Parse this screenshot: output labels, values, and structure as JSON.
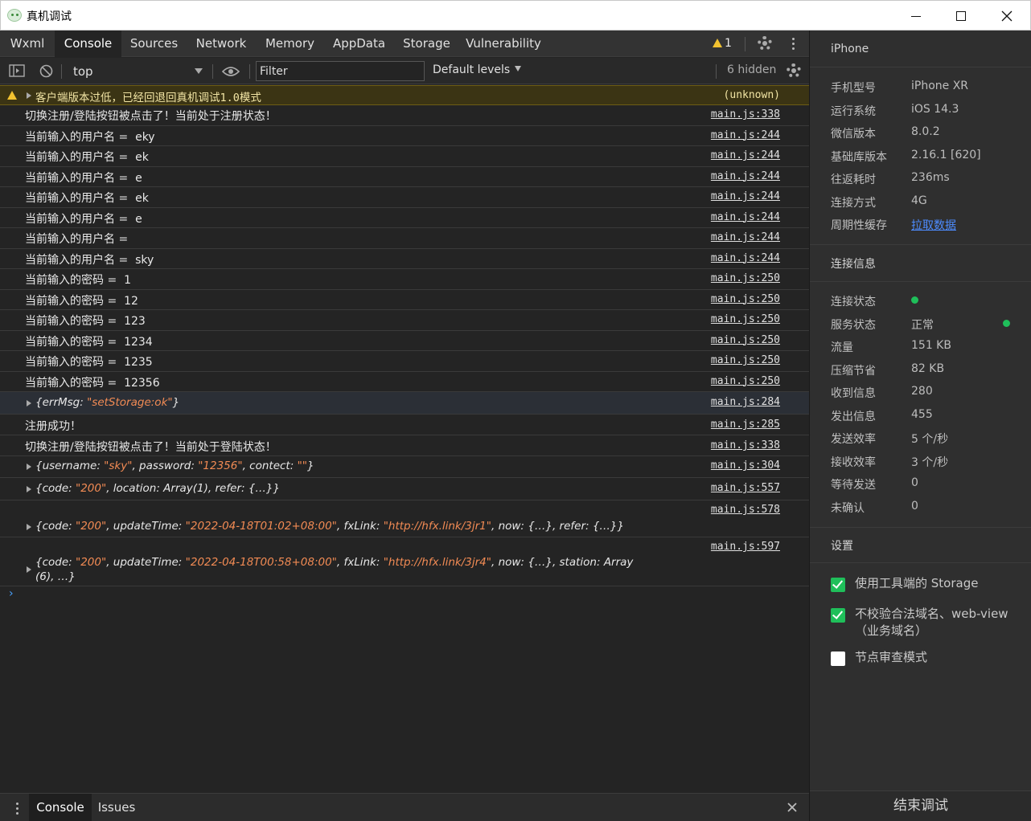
{
  "window": {
    "title": "真机调试"
  },
  "tabs": [
    "Wxml",
    "Console",
    "Sources",
    "Network",
    "Memory",
    "AppData",
    "Storage",
    "Vulnerability"
  ],
  "active_tab": "Console",
  "warning_count": "1",
  "toolbar": {
    "context": "top",
    "filter_placeholder": "Filter",
    "levels": "Default levels",
    "hidden": "6 hidden"
  },
  "console": {
    "warning": {
      "text": "客户端版本过低，已经回退回真机调试1.0模式",
      "source": "(unknown)"
    },
    "rows": [
      {
        "text": "切换注册/登陆按钮被点击了！当前处于注册状态！",
        "source": "main.js:338"
      },
      {
        "text": "当前输入的用户名 =  eky",
        "source": "main.js:244"
      },
      {
        "text": "当前输入的用户名 =  ek",
        "source": "main.js:244"
      },
      {
        "text": "当前输入的用户名 =  e",
        "source": "main.js:244"
      },
      {
        "text": "当前输入的用户名 =  ek",
        "source": "main.js:244"
      },
      {
        "text": "当前输入的用户名 =  e",
        "source": "main.js:244"
      },
      {
        "text": "当前输入的用户名 =",
        "source": "main.js:244"
      },
      {
        "text": "当前输入的用户名 =  sky",
        "source": "main.js:244"
      },
      {
        "text": "当前输入的密码 =  1",
        "source": "main.js:250"
      },
      {
        "text": "当前输入的密码 =  12",
        "source": "main.js:250"
      },
      {
        "text": "当前输入的密码 =  123",
        "source": "main.js:250"
      },
      {
        "text": "当前输入的密码 =  1234",
        "source": "main.js:250"
      },
      {
        "text": "当前输入的密码 =  1235",
        "source": "main.js:250"
      },
      {
        "text": "当前输入的密码 =  12356",
        "source": "main.js:250"
      }
    ],
    "obj1": {
      "k1": "{errMsg: ",
      "v1": "\"setStorage:ok\"",
      "end": "}",
      "source": "main.js:284"
    },
    "row_success": {
      "text": "注册成功！",
      "source": "main.js:285"
    },
    "row_login": {
      "text": "切换注册/登陆按钮被点击了！当前处于登陆状态！",
      "source": "main.js:338"
    },
    "obj2": {
      "a": "{username: ",
      "b": "\"sky\"",
      "c": ", password: ",
      "d": "\"12356\"",
      "e": ", contect: ",
      "f": "\"\"",
      "g": "}",
      "source": "main.js:304"
    },
    "obj3": {
      "a": "{code: ",
      "b": "\"200\"",
      "c": ", location: Array(1), refer: {…}}",
      "source": "main.js:557"
    },
    "obj4": {
      "a": "{code: ",
      "b": "\"200\"",
      "c": ", updateTime: ",
      "d": "\"2022-04-18T01:02+08:00\"",
      "e": ", fxLink: ",
      "f": "\"http://hfx.link/3jr1\"",
      "g": ", now: {…}, refer: {…}}",
      "source": "main.js:578"
    },
    "obj5": {
      "a": "{code: ",
      "b": "\"200\"",
      "c": ", updateTime: ",
      "d": "\"2022-04-18T00:58+08:00\"",
      "e": ", fxLink: ",
      "f": "\"http://hfx.link/3jr4\"",
      "g": ", now: {…}, station: Array",
      "h": "(6), …}",
      "source": "main.js:597"
    },
    "prompt": "›"
  },
  "drawer": {
    "tabs": [
      "Console",
      "Issues"
    ]
  },
  "device": {
    "name": "iPhone",
    "fields": [
      {
        "label": "手机型号",
        "value": "iPhone XR"
      },
      {
        "label": "运行系统",
        "value": "iOS 14.3"
      },
      {
        "label": "微信版本",
        "value": "8.0.2"
      },
      {
        "label": "基础库版本",
        "value": "2.16.1 [620]"
      },
      {
        "label": "往返耗时",
        "value": "236ms"
      },
      {
        "label": "连接方式",
        "value": "4G"
      },
      {
        "label": "周期性缓存",
        "value": "拉取数据"
      }
    ]
  },
  "connection": {
    "title": "连接信息",
    "fields": [
      {
        "label": "连接状态",
        "value": ""
      },
      {
        "label": "服务状态",
        "value": "正常"
      },
      {
        "label": "流量",
        "value": "151 KB"
      },
      {
        "label": "压缩节省",
        "value": "82 KB"
      },
      {
        "label": "收到信息",
        "value": "280"
      },
      {
        "label": "发出信息",
        "value": "455"
      },
      {
        "label": "发送效率",
        "value": "5 个/秒"
      },
      {
        "label": "接收效率",
        "value": "3 个/秒"
      },
      {
        "label": "等待发送",
        "value": "0"
      },
      {
        "label": "未确认",
        "value": "0"
      }
    ],
    "status_color": "#1fbf5a"
  },
  "settings": {
    "title": "设置",
    "options": [
      {
        "label": "使用工具端的 Storage",
        "checked": true
      },
      {
        "label": "不校验合法域名、web-view（业务域名）",
        "checked": true
      },
      {
        "label": "节点审查模式",
        "checked": false
      }
    ]
  },
  "end_button": "结束调试"
}
